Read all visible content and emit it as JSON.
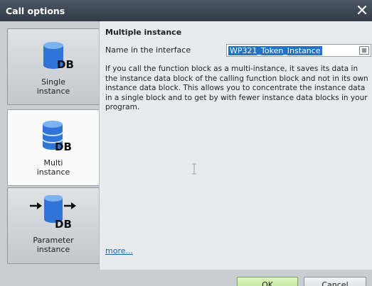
{
  "window": {
    "title": "Call options"
  },
  "options": [
    {
      "line1": "Single",
      "line2": "instance",
      "selected": false
    },
    {
      "line1": "Multi",
      "line2": "instance",
      "selected": true
    },
    {
      "line1": "Parameter",
      "line2": "instance",
      "selected": false
    }
  ],
  "icons": {
    "db_text": "DB",
    "db_color": "#2f74d6"
  },
  "content": {
    "heading": "Multiple instance",
    "name_label": "Name in the interface",
    "name_value": "WP321_Token_Instance",
    "description": "If you call the function block as a multi-instance, it saves its data in the instance data block of the calling function block and not in its own instance data block. This allows you to concentrate the instance data in a single block and to get by with fewer instance data blocks in your program.",
    "more_link": "more..."
  },
  "buttons": {
    "ok": "OK",
    "cancel": "Cancel"
  }
}
